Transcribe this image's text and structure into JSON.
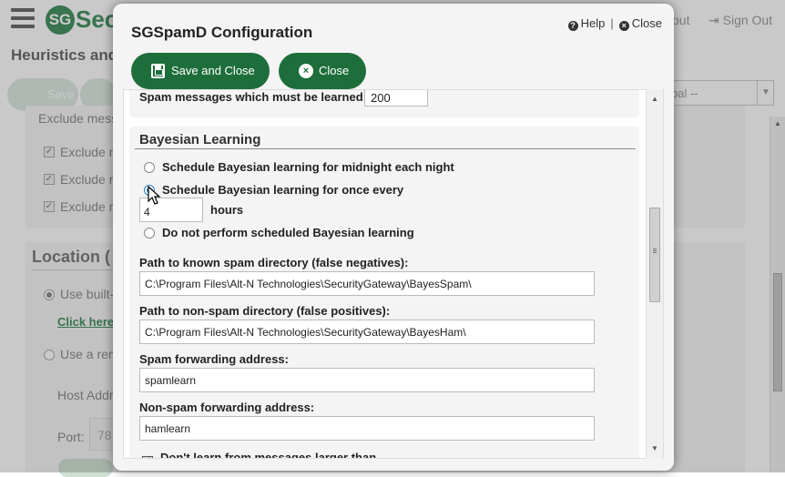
{
  "app": {
    "logo_badge": "SG",
    "logo_text": "Sec",
    "about": "out",
    "sign_out": "Sign Out",
    "page_heading": "Heuristics and",
    "save_label": "Save",
    "select_value": "bal --",
    "exclude_heading": "Exclude mess",
    "exclude_items": [
      "Exclude m",
      "Exclude m",
      "Exclude m"
    ],
    "location_title": "Location (",
    "use_builtin": "Use built-",
    "click_here": "Click here",
    "use_remote": "Use a rem",
    "host_address": "Host Addr",
    "port_label": "Port:",
    "port_value": "78"
  },
  "modal": {
    "title": "SGSpamD Configuration",
    "help_label": "Help",
    "separator": "|",
    "close_label": "Close",
    "save_and_close_button": "Save and Close",
    "close_button": "Close",
    "clipped_label": "Spam messages which must be learned:",
    "clipped_value": "200",
    "section_title": "Bayesian Learning",
    "radio_options": [
      {
        "label": "Schedule Bayesian learning for midnight each night",
        "checked": false
      },
      {
        "label": "Schedule Bayesian learning for once every",
        "checked": true
      },
      {
        "label": "Do not perform scheduled Bayesian learning",
        "checked": false
      }
    ],
    "hours_value": "4",
    "hours_label": "hours",
    "spam_dir_label": "Path to known spam directory (false negatives):",
    "spam_dir_value": "C:\\Program Files\\Alt-N Technologies\\SecurityGateway\\BayesSpam\\",
    "nonspam_dir_label": "Path to non-spam directory (false positives):",
    "nonspam_dir_value": "C:\\Program Files\\Alt-N Technologies\\SecurityGateway\\BayesHam\\",
    "spam_fwd_label": "Spam forwarding address:",
    "spam_fwd_value": "spamlearn",
    "nonspam_fwd_label": "Non-spam forwarding address:",
    "nonspam_fwd_value": "hamlearn",
    "dont_learn_label": "Don't learn from messages larger than",
    "dont_learn_checked": true
  },
  "icons": {
    "help": "question-circle-icon",
    "close": "x-circle-icon",
    "save": "floppy-disk-icon",
    "sign_out": "sign-out-icon"
  },
  "colors": {
    "brand_green": "#1e6e3b",
    "logo_green": "#3e8e5a",
    "radio_selected": "#2a7fd4"
  }
}
